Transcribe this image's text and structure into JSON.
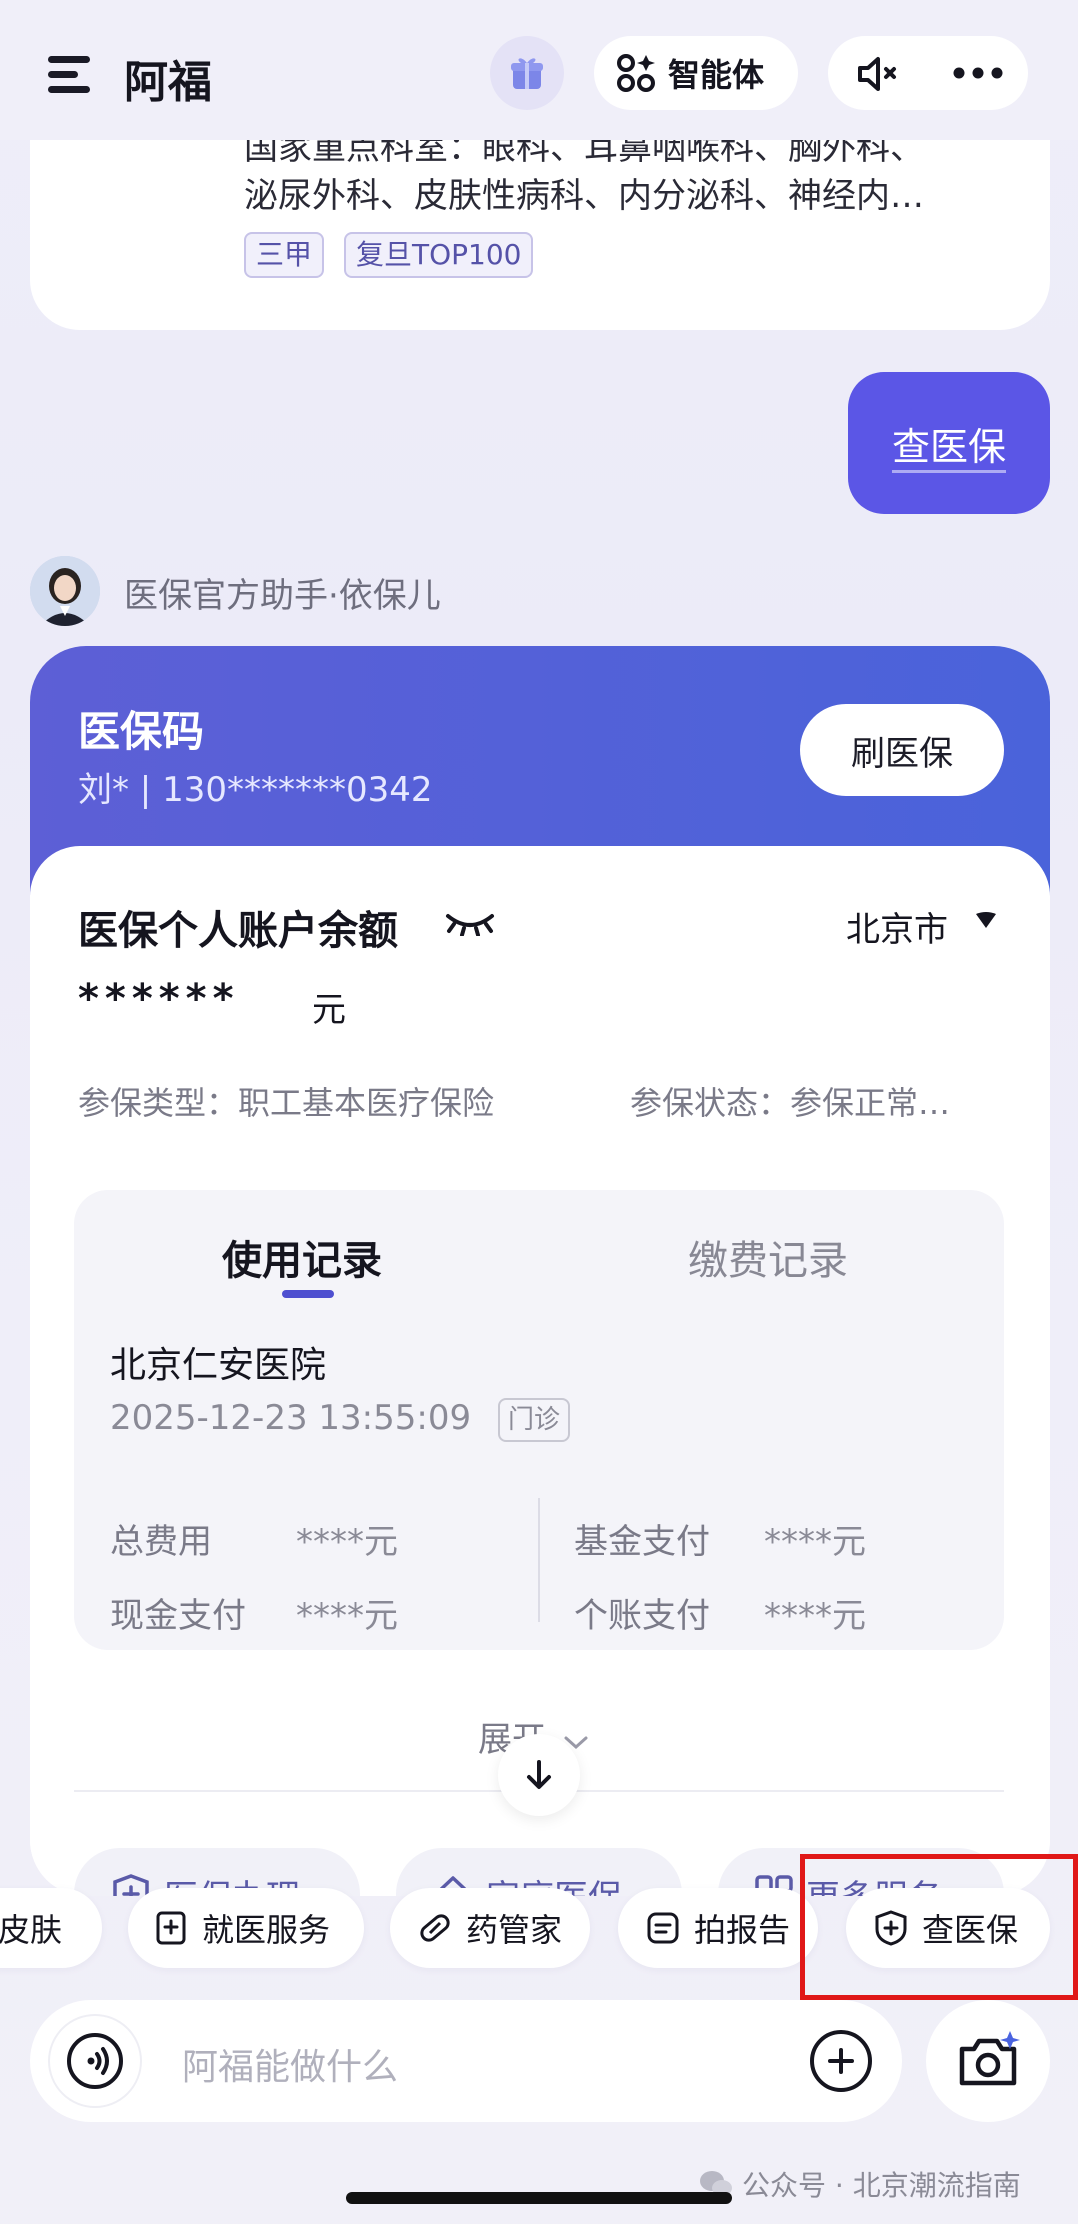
{
  "header": {
    "title": "阿福",
    "agent_label": "智能体"
  },
  "top_card": {
    "line1": "国家重点科室：眼科、耳鼻咽喉科、胸外科、",
    "line2": "泌尿外科、皮肤性病科、内分泌科、神经内…",
    "tags": [
      "三甲",
      "复旦TOP100"
    ]
  },
  "user_message": "查医保",
  "assistant": {
    "name": "医保官方助手·依保儿"
  },
  "insurance_card": {
    "title": "医保码",
    "user": "刘* | 130*******0342",
    "swipe_button": "刷医保",
    "balance_label": "医保个人账户余额",
    "city": "北京市",
    "balance_value": "******",
    "balance_unit": "元",
    "type_text": "参保类型：职工基本医疗保险",
    "status_text": "参保状态：参保正常…",
    "tabs": [
      "使用记录",
      "缴费记录"
    ],
    "record": {
      "hospital": "北京仁安医院",
      "time": "2025-12-23 13:55:09",
      "badge": "门诊",
      "total_label": "总费用",
      "total_value": "****元",
      "fund_label": "基金支付",
      "fund_value": "****元",
      "cash_label": "现金支付",
      "cash_value": "****元",
      "account_label": "个账支付",
      "account_value": "****元"
    },
    "expand_label": "展开",
    "services": [
      "医保办理",
      "家庭医保",
      "更多服务"
    ]
  },
  "chips": [
    "查皮肤",
    "就医服务",
    "药管家",
    "拍报告",
    "查医保"
  ],
  "input": {
    "placeholder": "阿福能做什么"
  },
  "watermark": "公众号 · 北京潮流指南",
  "colors": {
    "accent": "#5b56e6",
    "card_header": "#4e61d8",
    "highlight": "#e01818"
  }
}
